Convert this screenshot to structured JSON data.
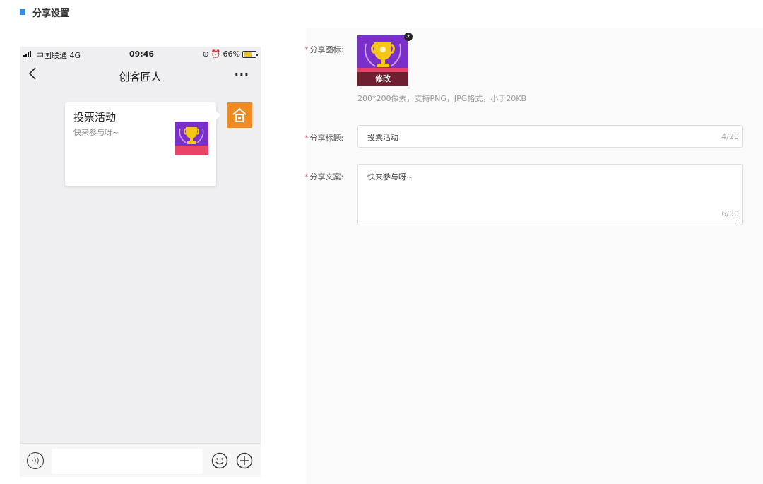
{
  "section": {
    "title": "分享设置",
    "accent": "#2f8bf0"
  },
  "phone": {
    "status": {
      "carrier": "中国联通 4G",
      "time": "09:46",
      "battery": "66%",
      "battery_level": 0.66
    },
    "nav": {
      "back_icon": "chevron-left-icon",
      "title": "创客匠人",
      "more": "···"
    },
    "card": {
      "title": "投票活动",
      "desc": "快来参与呀~",
      "thumb_label": "投 票"
    },
    "bottom": {
      "voice_icon": "voice-icon",
      "emoji_icon": "emoji-icon",
      "plus_icon": "plus-circle-icon"
    }
  },
  "form": {
    "required_mark": "*",
    "icon": {
      "label": "分享图标:",
      "modify": "修改",
      "hint": "200*200像素，支持PNG，JPG格式，小于20KB"
    },
    "title": {
      "label": "分享标题:",
      "value": "投票活动",
      "count": "4/20"
    },
    "desc": {
      "label": "分享文案:",
      "value": "快来参与呀~",
      "count": "6/30"
    }
  },
  "colors": {
    "required": "#f56c6c",
    "avatar": "#f08a22",
    "battery": "#f2c318",
    "icon_bg": "#7a2fc9"
  }
}
